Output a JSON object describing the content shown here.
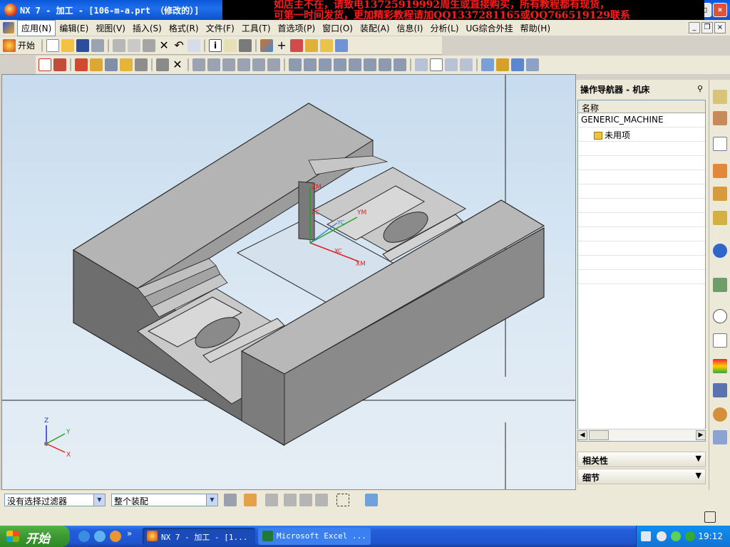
{
  "window": {
    "title": "NX 7 - 加工 - [106-m-a.prt （修改的）]"
  },
  "overlay_text": {
    "line1": "如店主不在，请致电13725919992周生或直接购买，所有教程都有现货，",
    "line2": "可第一时间发货，更加精彩教程请加QQ1337281165或QQ766519129联系"
  },
  "menu": {
    "items": [
      {
        "label": "应用(N)"
      },
      {
        "label": "编辑(E)"
      },
      {
        "label": "视图(V)"
      },
      {
        "label": "插入(S)"
      },
      {
        "label": "格式(R)"
      },
      {
        "label": "文件(F)"
      },
      {
        "label": "工具(T)"
      },
      {
        "label": "首选项(P)"
      },
      {
        "label": "窗口(O)"
      },
      {
        "label": "装配(A)"
      },
      {
        "label": "信息(I)"
      },
      {
        "label": "分析(L)"
      },
      {
        "label": "UG综合外挂"
      },
      {
        "label": "帮助(H)"
      }
    ]
  },
  "toolbar": {
    "start_label": "开始"
  },
  "viewport": {
    "wcs_labels": {
      "zm": "ZM",
      "ym": "YM",
      "xm": "XM",
      "zc": "ZC",
      "yc": "YC",
      "xc": "XC"
    },
    "triad": {
      "z": "Z",
      "y": "Y",
      "x": "X"
    }
  },
  "navigator": {
    "title": "操作导航器 - 机床",
    "column_header": "名称",
    "rows": [
      {
        "label": "GENERIC_MACHINE"
      },
      {
        "label": "未用项"
      }
    ],
    "sections": [
      {
        "label": "相关性"
      },
      {
        "label": "细节"
      }
    ]
  },
  "statusbar": {
    "filter_value": "没有选择过滤器",
    "scope_value": "整个装配"
  },
  "taskbar": {
    "start_label": "开始",
    "tasks": [
      {
        "label": "NX 7 - 加工 - [1..."
      },
      {
        "label": "Microsoft Excel ..."
      }
    ],
    "clock": "19:12"
  },
  "colors": {
    "titlebar": "#0a57d8",
    "overlay_text": "#ff1a1a",
    "part_face": "#8c8c8c",
    "viewport_bg": "#d6e4f1",
    "xp_green": "#3c9932"
  }
}
